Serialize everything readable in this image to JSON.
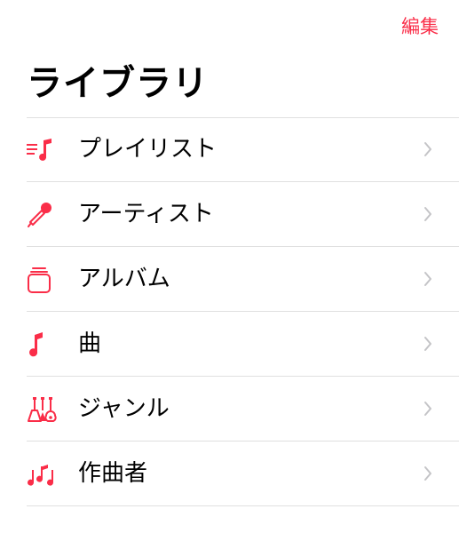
{
  "nav": {
    "edit_label": "編集"
  },
  "title": "ライブラリ",
  "accent_color": "#fa2d48",
  "items": [
    {
      "label": "プレイリスト",
      "icon": "playlist-icon"
    },
    {
      "label": "アーティスト",
      "icon": "microphone-icon"
    },
    {
      "label": "アルバム",
      "icon": "album-icon"
    },
    {
      "label": "曲",
      "icon": "music-note-icon"
    },
    {
      "label": "ジャンル",
      "icon": "guitars-icon"
    },
    {
      "label": "作曲者",
      "icon": "composer-notes-icon"
    }
  ]
}
